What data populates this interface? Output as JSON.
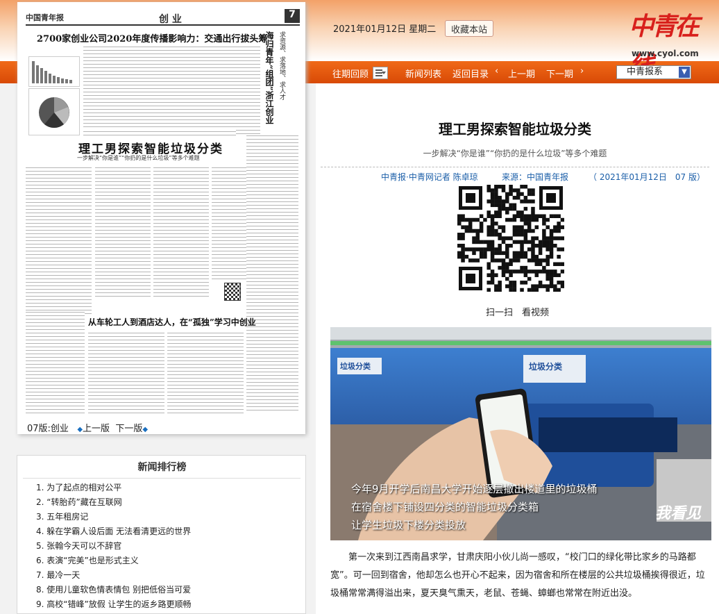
{
  "header": {
    "date": "2021年01月12日 星期二",
    "favorite_label": "收藏本站",
    "logo_text": "中青在线",
    "logo_url": "www.cyol.com"
  },
  "nav": {
    "back_issues": "往期回顾",
    "news_list": "新闻列表",
    "return_index": "返回目录",
    "prev_issue": "上一期",
    "next_issue": "下一期",
    "select_value": "中青报系"
  },
  "newspaper": {
    "logo": "中国青年报",
    "section": "创 业",
    "page_no": "7",
    "headline_top": "2700家创业公司2020年度传播影响力：交通出行拔头筹",
    "vertical_title": "海归青年“组团”浙江创业",
    "vertical_sub": "求资源、求落地、求人才",
    "headline_main": "理工男探索智能垃圾分类",
    "headline_main_sub": "一步解决“你是谁”“你扔的是什么垃圾”等多个难题",
    "headline_bottom": "从车轮工人到酒店达人，在“孤独”学习中创业",
    "footer_page": "07版:创业",
    "footer_prev": "上一版",
    "footer_next": "下一版"
  },
  "ranking": {
    "title": "新闻排行榜",
    "items": [
      "1. 为了起点的相对公平",
      "2. “转胎药”藏在互联网",
      "3. 五年租房记",
      "4. 躲在学霸人设后面 无法看清更远的世界",
      "5. 张翰今天可以不辞官",
      "6. 表演“完美”也是形式主义",
      "7. 最冷一天",
      "8. 使用儿童软色情表情包 别把低俗当可爱",
      "9. 高校“错峰”放假 让学生的返乡路更顺畅"
    ]
  },
  "article": {
    "title": "理工男探索智能垃圾分类",
    "subtitle": "一步解决“你是谁”“你扔的是什么垃圾”等多个难题",
    "author": "中青报·中青网记者 陈卓琼",
    "source": "来源：中国青年报",
    "date_page": "（ 2021年01月12日　07 版）",
    "scan_label": "扫一扫　看视频",
    "video_captions": [
      "今年9月开学后南昌大学开始逐层撤出楼道里的垃圾桶",
      "在宿舍楼下铺设四分类的智能垃圾分类箱",
      "让学生垃圾下楼分类投放"
    ],
    "video_sign1": "垃圾分类",
    "video_sign2": "垃圾分类",
    "video_watermark": "我看见",
    "body": "第一次来到江西南昌求学，甘肃庆阳小伙儿尚一感叹，“校门口的绿化带比家乡的马路都宽”。可一回到宿舍，他却怎么也开心不起来，因为宿舍和所在楼层的公共垃圾桶挨得很近，垃圾桶常常满得溢出来，夏天臭气熏天，老鼠、苍蝇、蟑螂也常常在附近出没。"
  }
}
